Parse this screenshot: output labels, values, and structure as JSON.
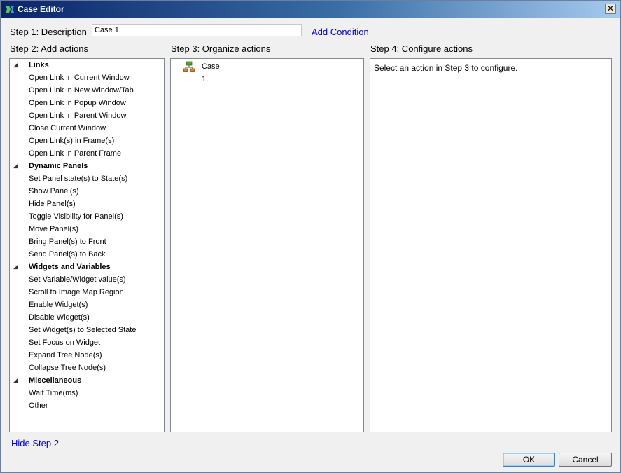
{
  "window": {
    "title": "Case Editor",
    "close_glyph": "✕"
  },
  "step1": {
    "label": "Step 1: Description",
    "value": "Case 1",
    "add_condition": "Add Condition"
  },
  "step2": {
    "label": "Step 2: Add actions",
    "groups": [
      {
        "name": "Links",
        "items": [
          "Open Link in Current Window",
          "Open Link in New Window/Tab",
          "Open Link in Popup Window",
          "Open Link in Parent Window",
          "Close Current Window",
          "Open Link(s) in Frame(s)",
          "Open Link in Parent Frame"
        ]
      },
      {
        "name": "Dynamic Panels",
        "items": [
          "Set Panel state(s) to State(s)",
          "Show Panel(s)",
          "Hide Panel(s)",
          "Toggle Visibility for Panel(s)",
          "Move Panel(s)",
          "Bring Panel(s) to Front",
          "Send Panel(s) to Back"
        ]
      },
      {
        "name": "Widgets and Variables",
        "items": [
          "Set Variable/Widget value(s)",
          "Scroll to Image Map Region",
          "Enable Widget(s)",
          "Disable Widget(s)",
          "Set Widget(s) to Selected State",
          "Set Focus on Widget",
          "Expand Tree Node(s)",
          "Collapse Tree Node(s)"
        ]
      },
      {
        "name": "Miscellaneous",
        "items": [
          "Wait Time(ms)",
          "Other"
        ]
      }
    ]
  },
  "step3": {
    "label": "Step 3: Organize actions",
    "case_name": "Case 1"
  },
  "step4": {
    "label": "Step 4: Configure actions",
    "hint": "Select an action in Step 3 to configure."
  },
  "footer": {
    "hide_step2": "Hide Step 2",
    "ok": "OK",
    "cancel": "Cancel"
  },
  "colors": {
    "title_start": "#0a246a",
    "title_end": "#a6caf0",
    "link": "#0000d0"
  },
  "icons": {
    "title": "app-logo-icon",
    "case": "case-tree-icon",
    "group_toggle": "collapse-triangle-icon"
  }
}
